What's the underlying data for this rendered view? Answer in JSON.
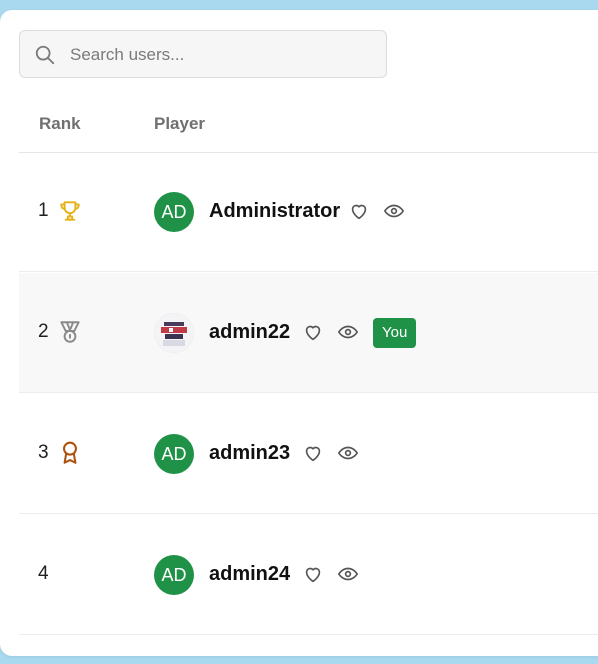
{
  "search": {
    "placeholder": "Search users..."
  },
  "table": {
    "headers": {
      "rank": "Rank",
      "player": "Player"
    },
    "rows": [
      {
        "rank": "1",
        "rank_icon": "trophy-icon",
        "avatar": "AD",
        "avatar_type": "initials",
        "name": "Administrator",
        "badge": ""
      },
      {
        "rank": "2",
        "rank_icon": "medal-icon",
        "avatar": "",
        "avatar_type": "photo",
        "name": "admin22",
        "badge": "You"
      },
      {
        "rank": "3",
        "rank_icon": "award-ribbon-icon",
        "avatar": "AD",
        "avatar_type": "initials",
        "name": "admin23",
        "badge": ""
      },
      {
        "rank": "4",
        "rank_icon": "",
        "avatar": "AD",
        "avatar_type": "initials",
        "name": "admin24",
        "badge": ""
      }
    ]
  },
  "colors": {
    "accent_green": "#1f9247",
    "gold": "#e5b319",
    "silver": "#8a8a8a",
    "bronze": "#b0520f",
    "background": "#a9d9ef"
  }
}
